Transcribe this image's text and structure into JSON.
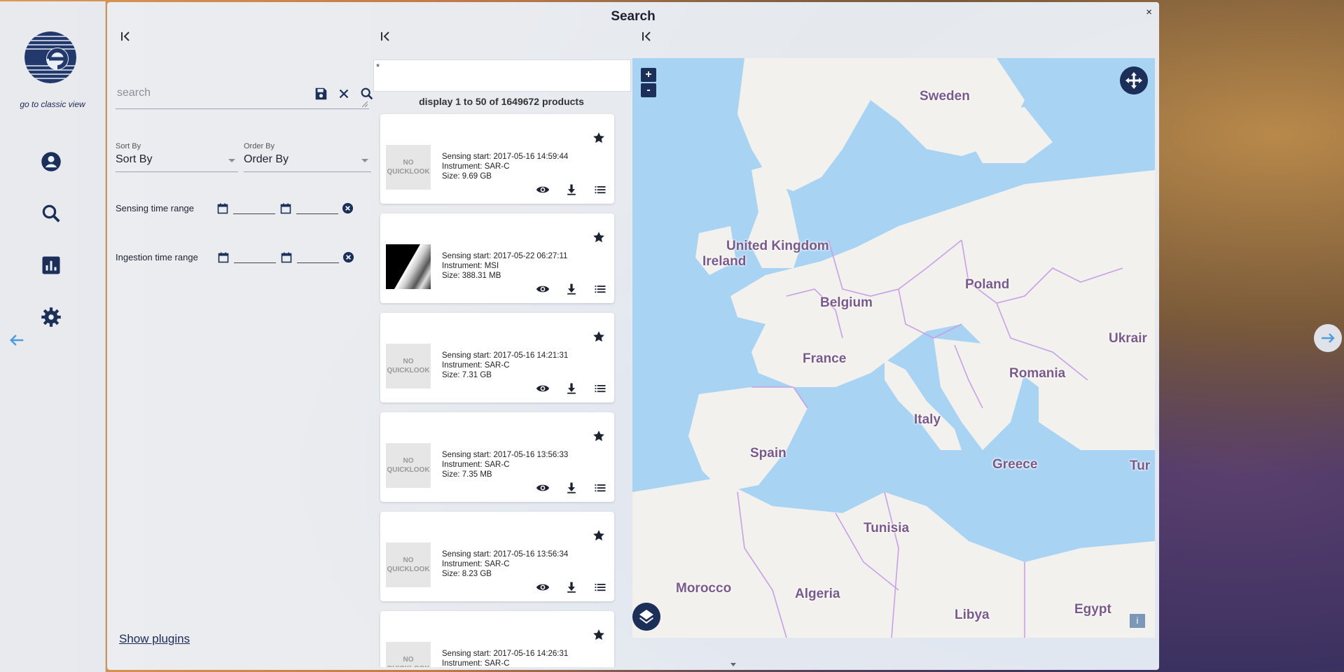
{
  "nav": {
    "classic_link": "go to classic view",
    "icons": [
      "account-icon",
      "search-icon",
      "stats-icon",
      "settings-icon"
    ]
  },
  "panel": {
    "title": "Search",
    "close": "×"
  },
  "search": {
    "placeholder": "search",
    "sort_by_label": "Sort By",
    "sort_by_value": "Sort By",
    "order_by_label": "Order By",
    "order_by_value": "Order By",
    "sensing_label": "Sensing time range",
    "ingestion_label": "Ingestion time range",
    "show_plugins": "Show plugins"
  },
  "results": {
    "query": "*",
    "count_text": "display 1 to 50 of 1649672 products",
    "no_quicklook": "NO QUICKLOOK",
    "items": [
      {
        "sensing": "Sensing start: 2017-05-16 14:59:44",
        "instrument": "Instrument: SAR-C",
        "size": "Size: 9.69 GB",
        "quicklook": false
      },
      {
        "sensing": "Sensing start: 2017-05-22 06:27:11",
        "instrument": "Instrument: MSI",
        "size": "Size: 388.31 MB",
        "quicklook": true
      },
      {
        "sensing": "Sensing start: 2017-05-16 14:21:31",
        "instrument": "Instrument: SAR-C",
        "size": "Size: 7.31 GB",
        "quicklook": false
      },
      {
        "sensing": "Sensing start: 2017-05-16 13:56:33",
        "instrument": "Instrument: SAR-C",
        "size": "Size: 7.35 MB",
        "quicklook": false
      },
      {
        "sensing": "Sensing start: 2017-05-16 13:56:34",
        "instrument": "Instrument: SAR-C",
        "size": "Size: 8.23 GB",
        "quicklook": false
      },
      {
        "sensing": "Sensing start: 2017-05-16 14:26:31",
        "instrument": "Instrument: SAR-C",
        "size": "",
        "quicklook": false
      }
    ]
  },
  "map": {
    "zoom_in": "+",
    "zoom_out": "-",
    "info": "i",
    "countries": [
      "Sweden",
      "United Kingdom",
      "Ireland",
      "Poland",
      "Belgium",
      "France",
      "Ukrair",
      "Romania",
      "Italy",
      "Spain",
      "Greece",
      "Tur",
      "Tunisia",
      "Morocco",
      "Algeria",
      "Libya",
      "Egypt"
    ]
  },
  "colors": {
    "brand": "#1b2f59",
    "water": "#a9d3f3",
    "land": "#f2f1ee",
    "border": "#c7a0e6"
  }
}
